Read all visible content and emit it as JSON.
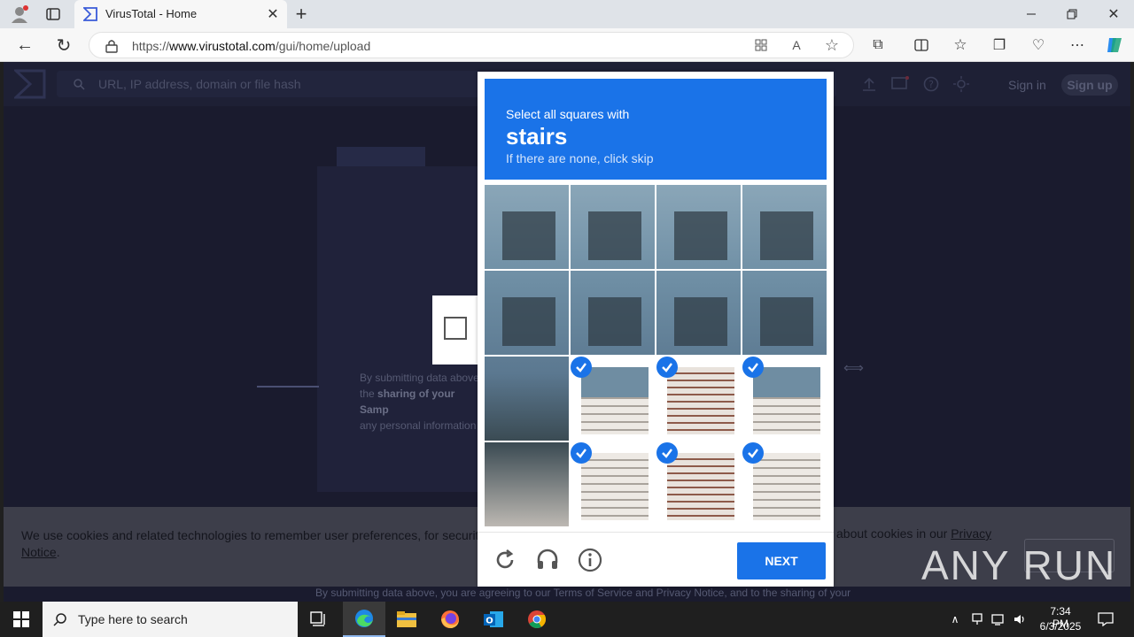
{
  "browser": {
    "tab_title": "VirusTotal - Home",
    "url_prefix": "https://",
    "url_domain": "www.virustotal.com",
    "url_path": "/gui/home/upload"
  },
  "vt": {
    "search_placeholder": "URL, IP address, domain or file hash",
    "sign_in": "Sign in",
    "sign_up": "Sign up",
    "content_line1": "By submitting data above,",
    "content_line2a": "the ",
    "content_line2b": "sharing of your Samp",
    "content_line3": "any personal information"
  },
  "cookie": {
    "text_a": "We use cookies and related technologies to remember user preferences, for security, to",
    "text_right": "about cookies in our ",
    "link1": "Privacy",
    "link2": "Notice",
    "period": "."
  },
  "bottom_text": "By submitting data above, you are agreeing to our Terms of Service and Privacy Notice, and to the sharing of your",
  "captcha": {
    "instruction_line1": "Select all squares with",
    "target": "stairs",
    "instruction_line3": "If there are none, click skip",
    "next_label": "NEXT",
    "selected_tiles": [
      9,
      10,
      11,
      13,
      14,
      15
    ]
  },
  "watermark": "ANY RUN",
  "taskbar": {
    "search_placeholder": "Type here to search",
    "time": "7:34 PM",
    "date": "6/3/2025"
  }
}
